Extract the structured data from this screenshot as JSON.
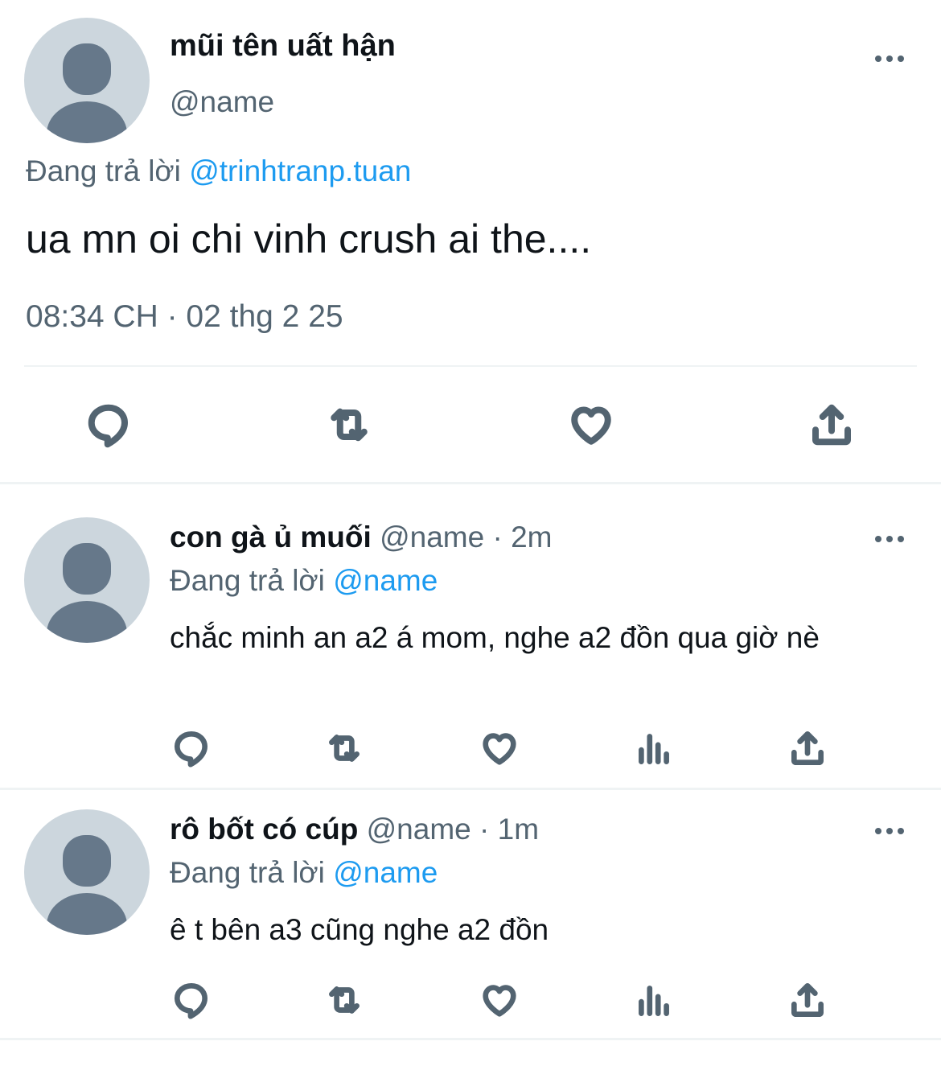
{
  "main_tweet": {
    "display_name": "mũi tên uất hận",
    "handle": "@name",
    "reply_prefix": "Đang trả lời",
    "reply_to": "@trinhtranp.tuan",
    "text": "ua mn oi chi vinh crush ai the....",
    "timestamp": "08:34 CH · 02 thg 2 25",
    "actions": [
      "reply-icon",
      "retweet-icon",
      "like-icon",
      "share-icon"
    ]
  },
  "replies": [
    {
      "display_name": "con gà ủ muối",
      "handle": "@name",
      "separator": "·",
      "time": "2m",
      "reply_prefix": "Đang trả lời",
      "reply_to": "@name",
      "text": "chắc minh an a2 á mom, nghe a2 đồn qua giờ nè",
      "actions": [
        "reply-icon",
        "retweet-icon",
        "like-icon",
        "views-icon",
        "share-icon"
      ]
    },
    {
      "display_name": "rô bốt có cúp",
      "handle": "@name",
      "separator": "·",
      "time": "1m",
      "reply_prefix": "Đang trả lời",
      "reply_to": "@name",
      "text": "ê t bên a3 cũng nghe a2 đồn",
      "actions": [
        "reply-icon",
        "retweet-icon",
        "like-icon",
        "views-icon",
        "share-icon"
      ]
    }
  ],
  "colors": {
    "link": "#1d9bf0",
    "secondary_text": "#536471",
    "primary_text": "#0f1419",
    "avatar_bg": "#ccd6dd",
    "avatar_fg": "#66788a",
    "divider": "#eff3f4"
  }
}
